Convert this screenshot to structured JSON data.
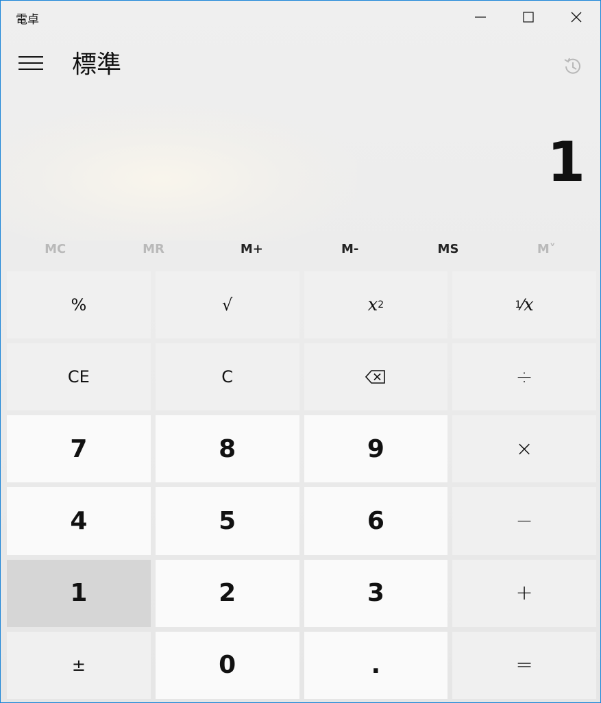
{
  "window": {
    "title": "電卓"
  },
  "header": {
    "mode": "標準"
  },
  "display": {
    "value": "1"
  },
  "memory": {
    "mc": "MC",
    "mr": "MR",
    "mplus": "M+",
    "mminus": "M-",
    "ms": "MS",
    "mlist": "M˅"
  },
  "keys": {
    "percent": "%",
    "sqrt": "√",
    "square_base": "x",
    "square_exp": "2",
    "recip_num": "1",
    "recip_den": "x",
    "ce": "CE",
    "c": "C",
    "divide": "÷",
    "n7": "7",
    "n8": "8",
    "n9": "9",
    "multiply": "×",
    "n4": "4",
    "n5": "5",
    "n6": "6",
    "minus": "−",
    "n1": "1",
    "n2": "2",
    "n3": "3",
    "plus": "+",
    "negate": "±",
    "n0": "0",
    "decimal": ".",
    "equals": "="
  },
  "state": {
    "pressed_key": "1"
  },
  "icons": {
    "menu": "hamburger-menu-icon",
    "history": "history-icon",
    "backspace": "backspace-icon",
    "minimize": "minimize-icon",
    "maximize": "maximize-icon",
    "close": "close-icon"
  },
  "colors": {
    "accent_border": "#1883d7",
    "pressed_key": "#d6d6d6"
  }
}
